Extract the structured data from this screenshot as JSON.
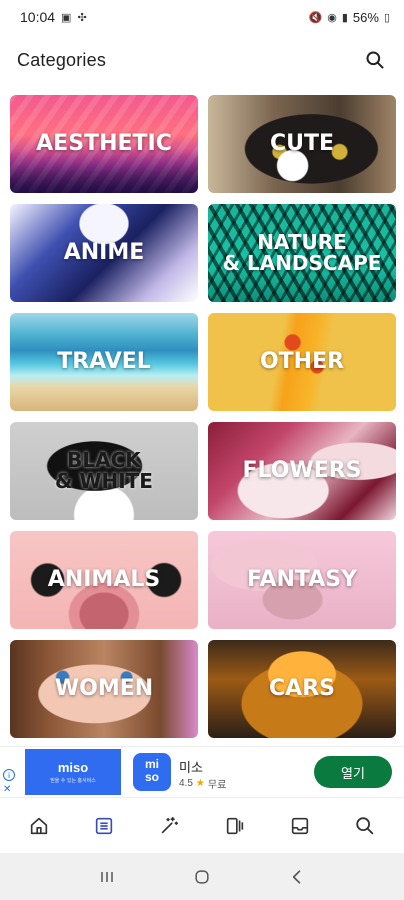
{
  "status_bar": {
    "time": "10:04",
    "battery": "56%"
  },
  "header": {
    "title": "Categories",
    "search_icon": "search-icon"
  },
  "categories": [
    {
      "label": "AESTHETIC"
    },
    {
      "label": "CUTE"
    },
    {
      "label": "ANIME"
    },
    {
      "label": "NATURE\n& LANDSCAPE"
    },
    {
      "label": "TRAVEL"
    },
    {
      "label": "OTHER"
    },
    {
      "label": "BLACK\n& WHITE"
    },
    {
      "label": "FLOWERS"
    },
    {
      "label": "ANIMALS"
    },
    {
      "label": "FANTASY"
    },
    {
      "label": "WOMEN"
    },
    {
      "label": "CARS"
    }
  ],
  "ad": {
    "banner_brand": "miso",
    "banner_sub": "믿을 수 있는 홈서비스",
    "logo_text": "mi\nso",
    "app_name": "미소",
    "rating": "4.5",
    "price": "무료",
    "cta": "열기"
  },
  "bottom_nav": [
    {
      "icon": "home-icon"
    },
    {
      "icon": "categories-icon",
      "active": true
    },
    {
      "icon": "magic-wand-icon"
    },
    {
      "icon": "wallpapers-icon"
    },
    {
      "icon": "inbox-icon"
    },
    {
      "icon": "search-icon"
    }
  ],
  "colors": {
    "accent": "#3b4bb5",
    "ad_cta": "#0b7a3e",
    "ad_brand": "#2f6cf0"
  }
}
